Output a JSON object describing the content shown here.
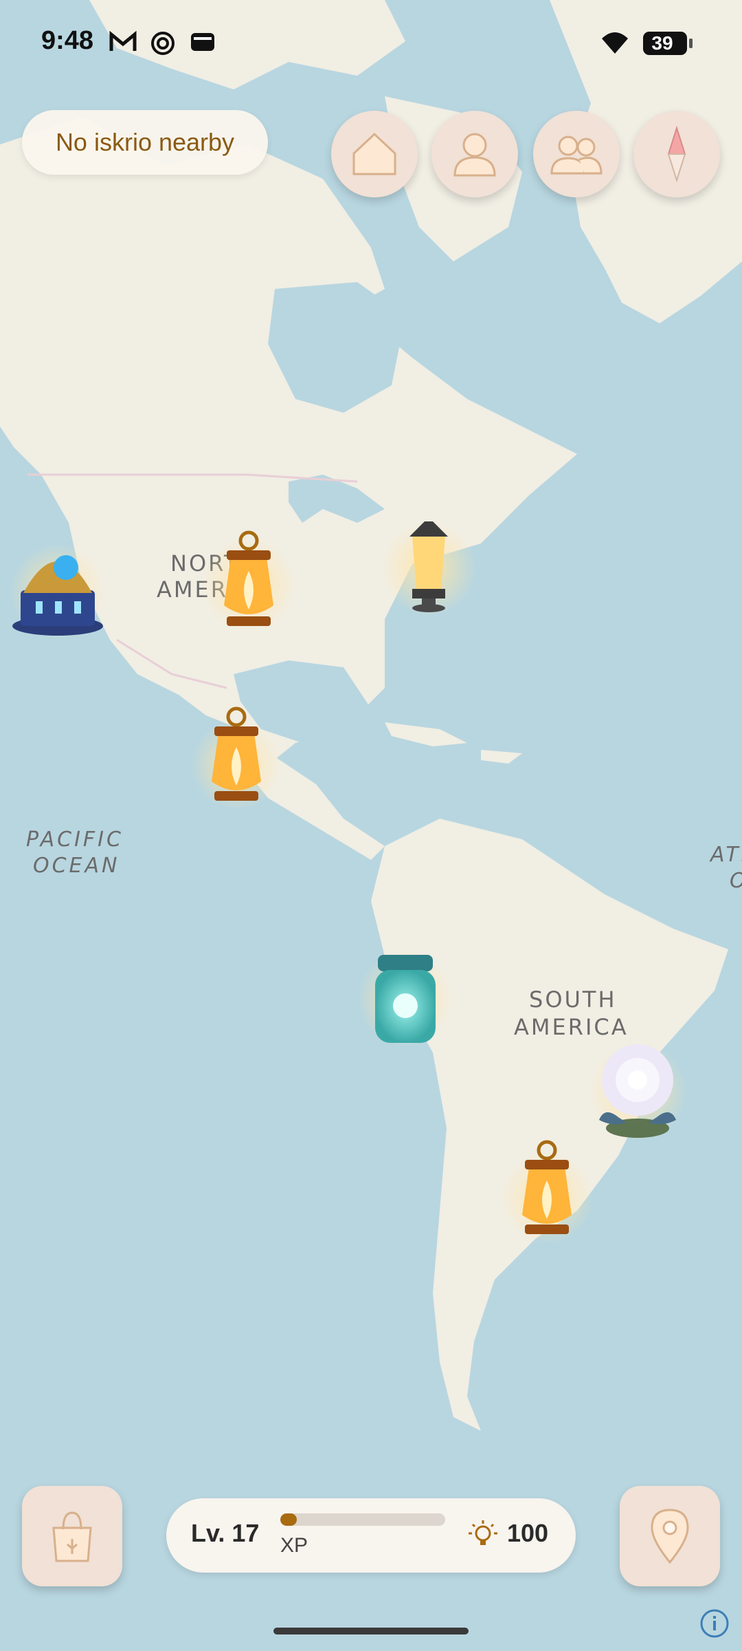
{
  "status_bar": {
    "time": "9:48",
    "notification_icons": [
      "gmail-icon",
      "threads-icon",
      "wallet-icon"
    ],
    "wifi": "wifi-icon",
    "battery": "39"
  },
  "nearby_label": "No iskrio nearby",
  "top_buttons": [
    "home-icon",
    "profile-icon",
    "friends-icon",
    "compass-icon"
  ],
  "map": {
    "labels": {
      "north_america_1": "NORTH",
      "north_america_2": "AMERICA",
      "south_america_1": "SOUTH",
      "south_america_2": "AMERICA",
      "pacific_1": "PACIFIC",
      "pacific_2": "OCEAN",
      "atlantic_1": "ATLANTIC",
      "atlantic_2": "OCEAN"
    },
    "markers": [
      "observatory-dome-icon",
      "lantern-icon",
      "street-lamp-icon",
      "lantern-icon",
      "glowing-jar-icon",
      "white-flower-icon",
      "lantern-icon"
    ]
  },
  "hud": {
    "level": "Lv. 17",
    "xp_label": "XP",
    "xp_progress": 0.1,
    "points": "100"
  },
  "colors": {
    "water": "#b8d6e0",
    "land": "#f1eee4",
    "button_bg": "#f1e1d6",
    "accent": "#a86b10"
  }
}
